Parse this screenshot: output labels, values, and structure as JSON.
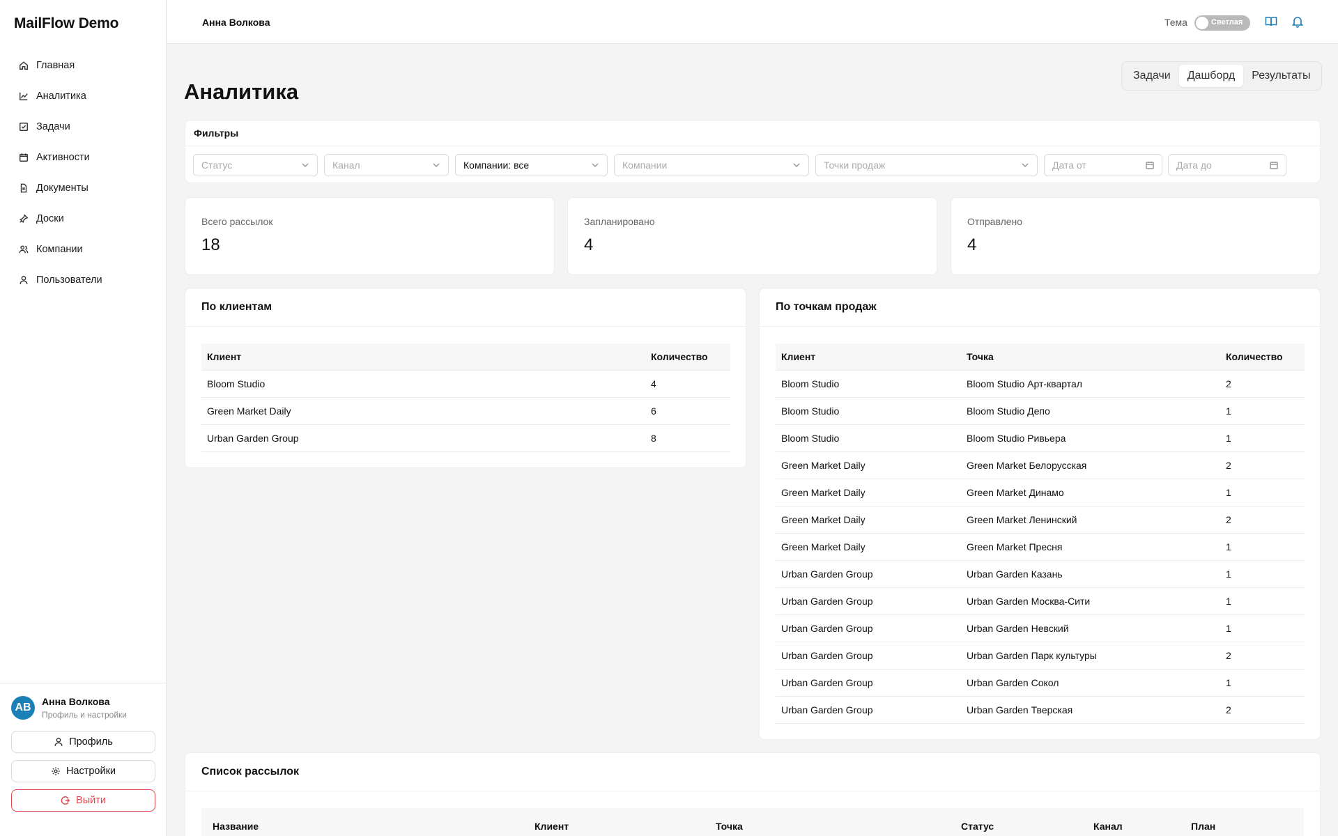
{
  "app": {
    "brand": "MailFlow Demo"
  },
  "sidebar": {
    "items": [
      {
        "label": "Главная",
        "icon": "home-icon"
      },
      {
        "label": "Аналитика",
        "icon": "chart-icon"
      },
      {
        "label": "Задачи",
        "icon": "checkbox-icon"
      },
      {
        "label": "Активности",
        "icon": "calendar-icon"
      },
      {
        "label": "Документы",
        "icon": "document-icon"
      },
      {
        "label": "Доски",
        "icon": "pin-icon"
      },
      {
        "label": "Компании",
        "icon": "users-icon"
      },
      {
        "label": "Пользователи",
        "icon": "user-icon"
      }
    ],
    "user": {
      "initials": "AB",
      "name": "Анна Волкова",
      "subtitle": "Профиль и настройки"
    },
    "profile_btn": "Профиль",
    "settings_btn": "Настройки",
    "logout_btn": "Выйти"
  },
  "topbar": {
    "user_name": "Анна Волкова",
    "theme_label": "Тема",
    "theme_value": "Светлая"
  },
  "page": {
    "title": "Аналитика",
    "tabs": [
      "Задачи",
      "Дашборд",
      "Результаты"
    ],
    "active_tab": "Дашборд"
  },
  "filters": {
    "title": "Фильтры",
    "status_placeholder": "Статус",
    "channel_placeholder": "Канал",
    "companies_mode": "Компании: все",
    "companies_placeholder": "Компании",
    "points_placeholder": "Точки продаж",
    "date_from_placeholder": "Дата от",
    "date_to_placeholder": "Дата до"
  },
  "stats": [
    {
      "label": "Всего рассылок",
      "value": "18"
    },
    {
      "label": "Запланировано",
      "value": "4"
    },
    {
      "label": "Отправлено",
      "value": "4"
    }
  ],
  "by_clients": {
    "title": "По клиентам",
    "headers": [
      "Клиент",
      "Количество"
    ],
    "rows": [
      [
        "Bloom Studio",
        "4"
      ],
      [
        "Green Market Daily",
        "6"
      ],
      [
        "Urban Garden Group",
        "8"
      ]
    ]
  },
  "by_points": {
    "title": "По точкам продаж",
    "headers": [
      "Клиент",
      "Точка",
      "Количество"
    ],
    "rows": [
      [
        "Bloom Studio",
        "Bloom Studio Арт-квартал",
        "2"
      ],
      [
        "Bloom Studio",
        "Bloom Studio Депо",
        "1"
      ],
      [
        "Bloom Studio",
        "Bloom Studio Ривьера",
        "1"
      ],
      [
        "Green Market Daily",
        "Green Market Белорусская",
        "2"
      ],
      [
        "Green Market Daily",
        "Green Market Динамо",
        "1"
      ],
      [
        "Green Market Daily",
        "Green Market Ленинский",
        "2"
      ],
      [
        "Green Market Daily",
        "Green Market Пресня",
        "1"
      ],
      [
        "Urban Garden Group",
        "Urban Garden Казань",
        "1"
      ],
      [
        "Urban Garden Group",
        "Urban Garden Москва-Сити",
        "1"
      ],
      [
        "Urban Garden Group",
        "Urban Garden Невский",
        "1"
      ],
      [
        "Urban Garden Group",
        "Urban Garden Парк культуры",
        "2"
      ],
      [
        "Urban Garden Group",
        "Urban Garden Сокол",
        "1"
      ],
      [
        "Urban Garden Group",
        "Urban Garden Тверская",
        "2"
      ]
    ]
  },
  "mailings": {
    "title": "Список рассылок",
    "headers": [
      "Название",
      "Клиент",
      "Точка",
      "Статус",
      "Канал",
      "План"
    ]
  },
  "colors": {
    "accent": "#1b7fb8",
    "danger": "#e0464b"
  }
}
